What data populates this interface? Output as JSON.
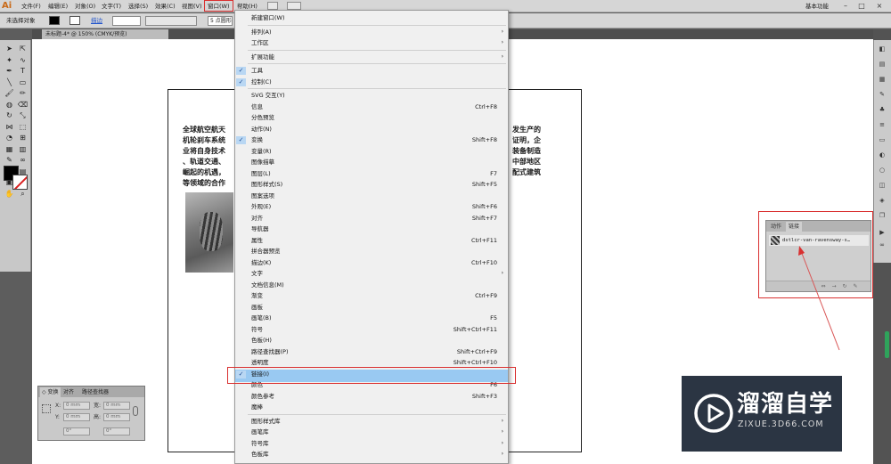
{
  "menubar": {
    "logo": "Ai",
    "items": [
      "文件(F)",
      "编辑(E)",
      "对象(O)",
      "文字(T)",
      "选择(S)",
      "效果(C)",
      "视图(V)",
      "窗口(W)",
      "帮助(H)"
    ],
    "workspace": "基本功能",
    "window_controls": [
      "–",
      "□",
      "×"
    ]
  },
  "controlbar": {
    "selection_text": "未选择对象",
    "stroke_label": "描边",
    "stroke_arrow": ":",
    "brush_label": "5 点圆形"
  },
  "document": {
    "tab_label": "未标题-4* @ 150% (CMYK/预览)",
    "close": "×"
  },
  "toolbox": {
    "icons": [
      "selection-tool-icon",
      "direct-selection-tool-icon",
      "magic-wand-tool-icon",
      "lasso-tool-icon",
      "pen-tool-icon",
      "type-tool-icon",
      "line-tool-icon",
      "rectangle-tool-icon",
      "paintbrush-tool-icon",
      "pencil-tool-icon",
      "blob-brush-tool-icon",
      "eraser-tool-icon",
      "rotate-tool-icon",
      "scale-tool-icon",
      "width-tool-icon",
      "free-transform-tool-icon",
      "shape-builder-tool-icon",
      "perspective-grid-tool-icon",
      "mesh-tool-icon",
      "gradient-tool-icon",
      "eyedropper-tool-icon",
      "blend-tool-icon",
      "symbol-sprayer-tool-icon",
      "column-graph-tool-icon",
      "artboard-tool-icon",
      "slice-tool-icon",
      "hand-tool-icon",
      "zoom-tool-icon"
    ]
  },
  "artboard": {
    "left_lines": [
      "全球航空航天",
      "机轮刹车系统",
      "业将自身技术",
      "、轨道交通、",
      "崛起的机遇，",
      "等领域的合作"
    ],
    "right_lines": [
      "发生产的",
      "证明，企",
      "装备制造",
      "中部地区",
      "配式建筑"
    ]
  },
  "window_menu": {
    "items": [
      {
        "label": "新建窗口(W)",
        "shortcut": "",
        "submenu": false,
        "checked": false
      },
      {
        "sep": true
      },
      {
        "label": "排列(A)",
        "shortcut": "",
        "submenu": true,
        "checked": false
      },
      {
        "label": "工作区",
        "shortcut": "",
        "submenu": true,
        "checked": false
      },
      {
        "sep": true
      },
      {
        "label": "扩展功能",
        "shortcut": "",
        "submenu": true,
        "checked": false
      },
      {
        "sep": true
      },
      {
        "label": "工具",
        "shortcut": "",
        "submenu": false,
        "checked": true
      },
      {
        "label": "控制(C)",
        "shortcut": "",
        "submenu": false,
        "checked": true
      },
      {
        "sep": true
      },
      {
        "label": "SVG 交互(Y)",
        "shortcut": "",
        "submenu": false,
        "checked": false
      },
      {
        "label": "信息",
        "shortcut": "Ctrl+F8",
        "submenu": false,
        "checked": false
      },
      {
        "label": "分色预览",
        "shortcut": "",
        "submenu": false,
        "checked": false
      },
      {
        "label": "动作(N)",
        "shortcut": "",
        "submenu": false,
        "checked": false
      },
      {
        "label": "变换",
        "shortcut": "Shift+F8",
        "submenu": false,
        "checked": true
      },
      {
        "label": "变量(R)",
        "shortcut": "",
        "submenu": false,
        "checked": false
      },
      {
        "label": "图像描摹",
        "shortcut": "",
        "submenu": false,
        "checked": false
      },
      {
        "label": "图层(L)",
        "shortcut": "F7",
        "submenu": false,
        "checked": false
      },
      {
        "label": "图形样式(S)",
        "shortcut": "Shift+F5",
        "submenu": false,
        "checked": false
      },
      {
        "label": "图案选项",
        "shortcut": "",
        "submenu": false,
        "checked": false
      },
      {
        "label": "外观(E)",
        "shortcut": "Shift+F6",
        "submenu": false,
        "checked": false
      },
      {
        "label": "对齐",
        "shortcut": "Shift+F7",
        "submenu": false,
        "checked": false
      },
      {
        "label": "导航器",
        "shortcut": "",
        "submenu": false,
        "checked": false
      },
      {
        "label": "属性",
        "shortcut": "Ctrl+F11",
        "submenu": false,
        "checked": false
      },
      {
        "label": "拼合器预览",
        "shortcut": "",
        "submenu": false,
        "checked": false
      },
      {
        "label": "描边(K)",
        "shortcut": "Ctrl+F10",
        "submenu": false,
        "checked": false
      },
      {
        "label": "文字",
        "shortcut": "",
        "submenu": true,
        "checked": false
      },
      {
        "label": "文档信息(M)",
        "shortcut": "",
        "submenu": false,
        "checked": false
      },
      {
        "label": "渐变",
        "shortcut": "Ctrl+F9",
        "submenu": false,
        "checked": false
      },
      {
        "label": "画板",
        "shortcut": "",
        "submenu": false,
        "checked": false
      },
      {
        "label": "画笔(B)",
        "shortcut": "F5",
        "submenu": false,
        "checked": false
      },
      {
        "label": "符号",
        "shortcut": "Shift+Ctrl+F11",
        "submenu": false,
        "checked": false
      },
      {
        "label": "色板(H)",
        "shortcut": "",
        "submenu": false,
        "checked": false
      },
      {
        "label": "路径查找器(P)",
        "shortcut": "Shift+Ctrl+F9",
        "submenu": false,
        "checked": false
      },
      {
        "label": "透明度",
        "shortcut": "Shift+Ctrl+F10",
        "submenu": false,
        "checked": false
      },
      {
        "label": "链接(I)",
        "shortcut": "",
        "submenu": false,
        "checked": true,
        "highlighted": true
      },
      {
        "label": "颜色",
        "shortcut": "F6",
        "submenu": false,
        "checked": false
      },
      {
        "label": "颜色参考",
        "shortcut": "Shift+F3",
        "submenu": false,
        "checked": false
      },
      {
        "label": "魔棒",
        "shortcut": "",
        "submenu": false,
        "checked": false
      },
      {
        "sep": true
      },
      {
        "label": "图形样式库",
        "shortcut": "",
        "submenu": true,
        "checked": false
      },
      {
        "label": "画笔库",
        "shortcut": "",
        "submenu": true,
        "checked": false
      },
      {
        "label": "符号库",
        "shortcut": "",
        "submenu": true,
        "checked": false
      },
      {
        "label": "色板库",
        "shortcut": "",
        "submenu": true,
        "checked": false
      }
    ],
    "check_glyph": "✓",
    "arrow_glyph": "›"
  },
  "links_panel": {
    "tabs": [
      "动作",
      "链接"
    ],
    "filename": "dstlcr-van-ravensway-s…",
    "colors": {
      "frame": "#d93030"
    }
  },
  "transform_panel": {
    "tabs": [
      "◇ 变换",
      "对齐",
      "路径查找器"
    ],
    "x_label": "X:",
    "y_label": "Y:",
    "w_label": "宽:",
    "h_label": "高:",
    "x_value": "0 mm",
    "y_value": "0 mm",
    "w_value": "0 mm",
    "h_value": "0 mm",
    "angle1": "0°",
    "angle2": "0°"
  },
  "watermark": {
    "title": "溜溜自学",
    "url": "ZIXUE.3D66.COM"
  }
}
